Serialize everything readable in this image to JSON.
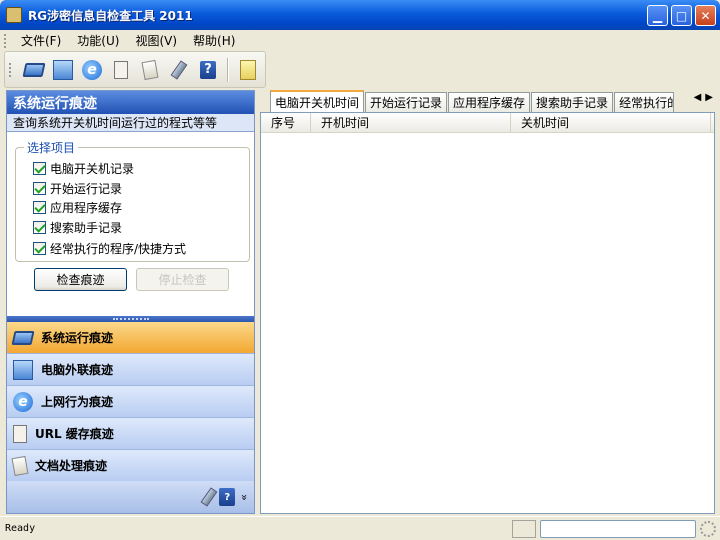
{
  "window": {
    "title": "RG涉密信息自检查工具 2011",
    "min": "▁",
    "max": "□",
    "close": "✕"
  },
  "menu": [
    "文件(F)",
    "功能(U)",
    "视图(V)",
    "帮助(H)"
  ],
  "toolbar": [
    {
      "icon": "system-run-trace-icon"
    },
    {
      "icon": "network-computer-icon"
    },
    {
      "icon": "internet-explorer-icon",
      "glyph": "e"
    },
    {
      "icon": "document-cache-icon"
    },
    {
      "icon": "document-scroll-icon"
    },
    {
      "icon": "usb-drive-icon"
    },
    {
      "icon": "help-book-icon",
      "glyph": "?"
    },
    {
      "icon": "user-key-icon"
    }
  ],
  "left_panel": {
    "title": "系统运行痕迹",
    "description": "查询系统开关机时间运行过的程式等等",
    "group_title": "选择项目",
    "options": [
      {
        "label": "电脑开关机记录",
        "checked": true
      },
      {
        "label": "开始运行记录",
        "checked": true
      },
      {
        "label": "应用程序缓存",
        "checked": true
      },
      {
        "label": "搜索助手记录",
        "checked": true
      },
      {
        "label": "经常执行的程序/快捷方式",
        "checked": true
      }
    ],
    "check_button": "检查痕迹",
    "stop_button": "停止检查",
    "nav": [
      {
        "label": "系统运行痕迹",
        "icon": "system-run-trace-icon",
        "active": true
      },
      {
        "label": "电脑外联痕迹",
        "icon": "network-computer-icon",
        "active": false
      },
      {
        "label": "上网行为痕迹",
        "icon": "internet-explorer-icon",
        "active": false
      },
      {
        "label": "URL 缓存痕迹",
        "icon": "document-cache-icon",
        "active": false
      },
      {
        "label": "文档处理痕迹",
        "icon": "document-scroll-icon",
        "active": false
      }
    ],
    "footer_icons": [
      "usb-drive-icon",
      "help-book-icon",
      "chevron-double-down-icon"
    ]
  },
  "tabs": [
    "电脑开关机时间",
    "开始运行记录",
    "应用程序缓存",
    "搜索助手记录",
    "经常执行的"
  ],
  "tab_scroll": {
    "left": "◀",
    "right": "▶"
  },
  "list": {
    "columns": [
      "序号",
      "开机时间",
      "关机时间"
    ],
    "rows": []
  },
  "status": {
    "text": "Ready"
  }
}
